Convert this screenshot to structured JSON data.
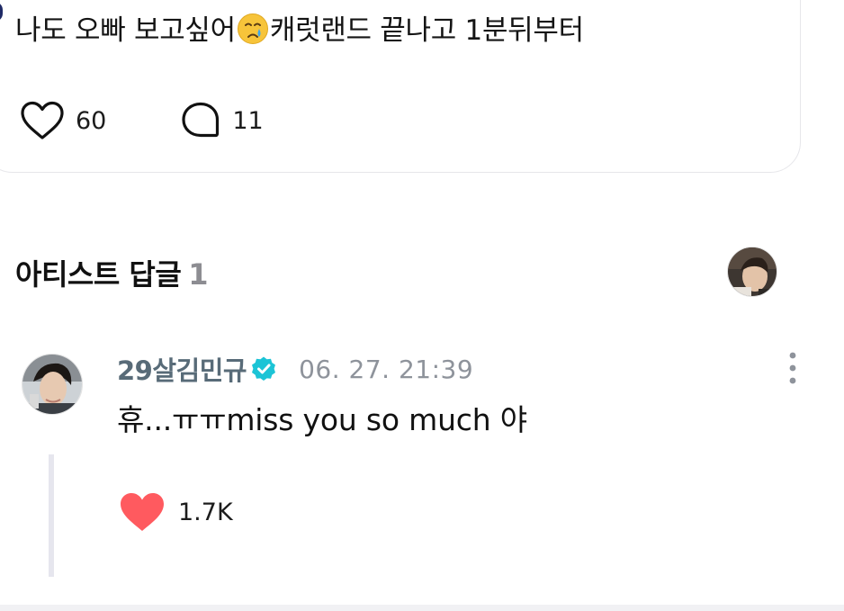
{
  "post": {
    "text_before_emoji": "나도 오빠 보고싶어",
    "emoji": "crying-face-emoji",
    "text_after_emoji": "캐럿랜드 끝나고 1분뒤부터",
    "like_count": "60",
    "comment_count": "11"
  },
  "artist_replies": {
    "title": "아티스트 답글",
    "count": "1"
  },
  "reply": {
    "author": "29살김민규",
    "timestamp": "06. 27. 21:39",
    "text": "휴...ㅠㅠmiss you so much 야",
    "like_count": "1.7K"
  },
  "icons": {
    "like": "heart-outline-icon",
    "comment": "comment-bubble-icon",
    "verified": "verified-badge-icon",
    "more": "more-vertical-icon",
    "reply_like": "heart-filled-icon"
  },
  "colors": {
    "author": "#586b78",
    "verified": "#1cc4d6",
    "heart": "#ff5a5f",
    "muted": "#8e939b"
  }
}
